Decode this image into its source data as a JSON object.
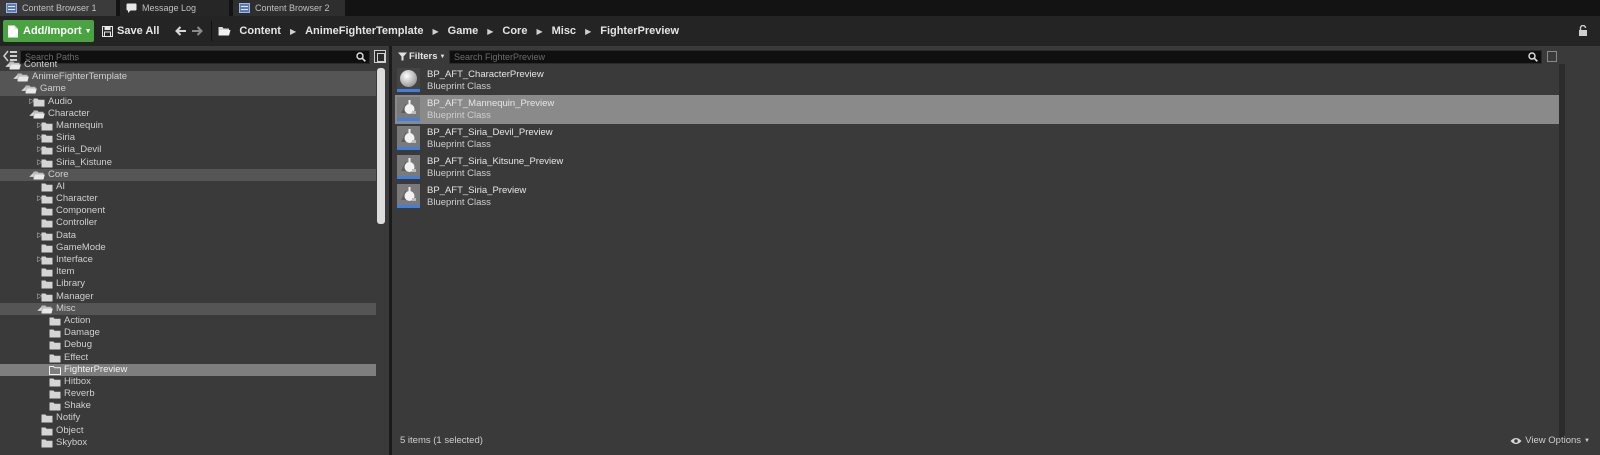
{
  "tabs": [
    {
      "label": "Content Browser 1",
      "icon": "content-browser-icon"
    },
    {
      "label": "Message Log",
      "icon": "message-log-icon"
    },
    {
      "label": "Content Browser 2",
      "icon": "content-browser-icon"
    }
  ],
  "toolbar": {
    "add_import_label": "Add/Import",
    "save_all_label": "Save All",
    "breadcrumbs": [
      "Content",
      "AnimeFighterTemplate",
      "Game",
      "Core",
      "Misc",
      "FighterPreview"
    ]
  },
  "left_panel": {
    "search_placeholder": "Search Paths",
    "tree": [
      {
        "label": "Content",
        "depth": 0,
        "state": "open"
      },
      {
        "label": "AnimeFighterTemplate",
        "depth": 1,
        "state": "open",
        "highlight": true
      },
      {
        "label": "Game",
        "depth": 2,
        "state": "open",
        "highlight": true
      },
      {
        "label": "Audio",
        "depth": 3,
        "state": "closed"
      },
      {
        "label": "Character",
        "depth": 3,
        "state": "open"
      },
      {
        "label": "Mannequin",
        "depth": 4,
        "state": "closed"
      },
      {
        "label": "Siria",
        "depth": 4,
        "state": "closed"
      },
      {
        "label": "Siria_Devil",
        "depth": 4,
        "state": "closed"
      },
      {
        "label": "Siria_Kistune",
        "depth": 4,
        "state": "closed"
      },
      {
        "label": "Core",
        "depth": 3,
        "state": "open",
        "highlight": true
      },
      {
        "label": "AI",
        "depth": 4,
        "state": "none"
      },
      {
        "label": "Character",
        "depth": 4,
        "state": "closed"
      },
      {
        "label": "Component",
        "depth": 4,
        "state": "none"
      },
      {
        "label": "Controller",
        "depth": 4,
        "state": "none"
      },
      {
        "label": "Data",
        "depth": 4,
        "state": "closed"
      },
      {
        "label": "GameMode",
        "depth": 4,
        "state": "none"
      },
      {
        "label": "Interface",
        "depth": 4,
        "state": "closed"
      },
      {
        "label": "Item",
        "depth": 4,
        "state": "none"
      },
      {
        "label": "Library",
        "depth": 4,
        "state": "none"
      },
      {
        "label": "Manager",
        "depth": 4,
        "state": "closed"
      },
      {
        "label": "Misc",
        "depth": 4,
        "state": "open",
        "highlight": true
      },
      {
        "label": "Action",
        "depth": 5,
        "state": "none"
      },
      {
        "label": "Damage",
        "depth": 5,
        "state": "none"
      },
      {
        "label": "Debug",
        "depth": 5,
        "state": "none"
      },
      {
        "label": "Effect",
        "depth": 5,
        "state": "none"
      },
      {
        "label": "FighterPreview",
        "depth": 5,
        "state": "none",
        "selected": true
      },
      {
        "label": "Hitbox",
        "depth": 5,
        "state": "none"
      },
      {
        "label": "Reverb",
        "depth": 5,
        "state": "none"
      },
      {
        "label": "Shake",
        "depth": 5,
        "state": "none"
      },
      {
        "label": "Notify",
        "depth": 4,
        "state": "none"
      },
      {
        "label": "Object",
        "depth": 4,
        "state": "none"
      },
      {
        "label": "Skybox",
        "depth": 4,
        "state": "none"
      }
    ]
  },
  "right_panel": {
    "filters_label": "Filters",
    "search_placeholder": "Search FighterPreview",
    "assets": [
      {
        "name": "BP_AFT_CharacterPreview",
        "type": "Blueprint Class",
        "thumb": "sphere"
      },
      {
        "name": "BP_AFT_Mannequin_Preview",
        "type": "Blueprint Class",
        "thumb": "figure",
        "selected": true
      },
      {
        "name": "BP_AFT_Siria_Devil_Preview",
        "type": "Blueprint Class",
        "thumb": "figure"
      },
      {
        "name": "BP_AFT_Siria_Kitsune_Preview",
        "type": "Blueprint Class",
        "thumb": "figure"
      },
      {
        "name": "BP_AFT_Siria_Preview",
        "type": "Blueprint Class",
        "thumb": "figure"
      }
    ],
    "status": "5 items (1 selected)",
    "view_options_label": "View Options"
  },
  "colors": {
    "add_button": "#48a340",
    "selection": "#7e7e7e",
    "thumb_accent": "#3f7fe0"
  }
}
